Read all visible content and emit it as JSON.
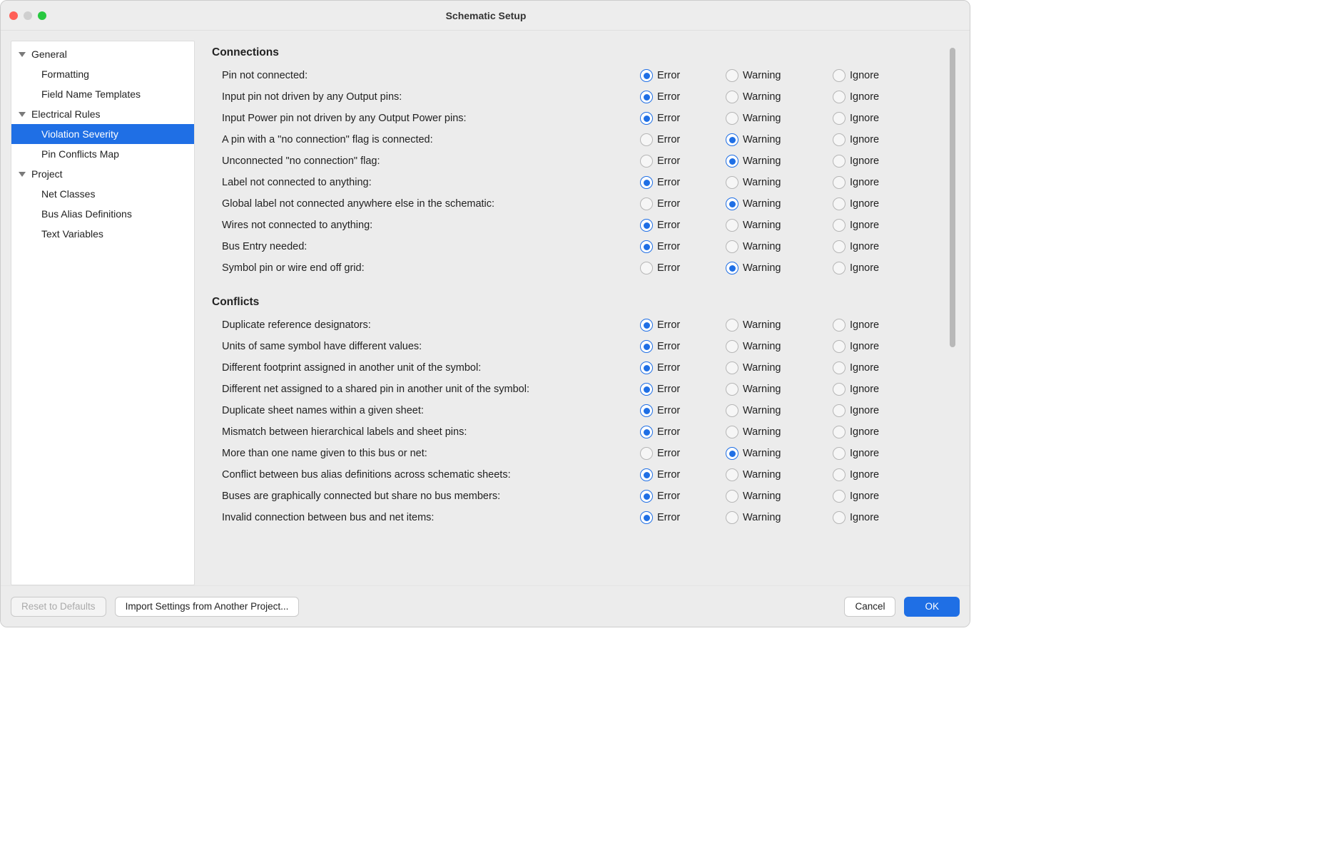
{
  "window": {
    "title": "Schematic Setup"
  },
  "sidebar": [
    {
      "label": "General",
      "indent": 0,
      "expandable": true,
      "selected": false
    },
    {
      "label": "Formatting",
      "indent": 1,
      "expandable": false,
      "selected": false
    },
    {
      "label": "Field Name Templates",
      "indent": 1,
      "expandable": false,
      "selected": false
    },
    {
      "label": "Electrical Rules",
      "indent": 0,
      "expandable": true,
      "selected": false
    },
    {
      "label": "Violation Severity",
      "indent": 1,
      "expandable": false,
      "selected": true
    },
    {
      "label": "Pin Conflicts Map",
      "indent": 1,
      "expandable": false,
      "selected": false
    },
    {
      "label": "Project",
      "indent": 0,
      "expandable": true,
      "selected": false
    },
    {
      "label": "Net Classes",
      "indent": 1,
      "expandable": false,
      "selected": false
    },
    {
      "label": "Bus Alias Definitions",
      "indent": 1,
      "expandable": false,
      "selected": false
    },
    {
      "label": "Text Variables",
      "indent": 1,
      "expandable": false,
      "selected": false
    }
  ],
  "options": {
    "error": "Error",
    "warning": "Warning",
    "ignore": "Ignore"
  },
  "sections": [
    {
      "title": "Connections",
      "rules": [
        {
          "label": "Pin not connected:",
          "value": "error"
        },
        {
          "label": "Input pin not driven by any Output pins:",
          "value": "error"
        },
        {
          "label": "Input Power pin not driven by any Output Power pins:",
          "value": "error"
        },
        {
          "label": "A pin with a \"no connection\" flag is connected:",
          "value": "warning"
        },
        {
          "label": "Unconnected \"no connection\" flag:",
          "value": "warning"
        },
        {
          "label": "Label not connected to anything:",
          "value": "error"
        },
        {
          "label": "Global label not connected anywhere else in the schematic:",
          "value": "warning"
        },
        {
          "label": "Wires not connected to anything:",
          "value": "error"
        },
        {
          "label": "Bus Entry needed:",
          "value": "error"
        },
        {
          "label": "Symbol pin or wire end off grid:",
          "value": "warning"
        }
      ]
    },
    {
      "title": "Conflicts",
      "rules": [
        {
          "label": "Duplicate reference designators:",
          "value": "error"
        },
        {
          "label": "Units of same symbol have different values:",
          "value": "error"
        },
        {
          "label": "Different footprint assigned in another unit of the symbol:",
          "value": "error"
        },
        {
          "label": "Different net assigned to a shared pin in another unit of the symbol:",
          "value": "error"
        },
        {
          "label": "Duplicate sheet names within a given sheet:",
          "value": "error"
        },
        {
          "label": "Mismatch between hierarchical labels and sheet pins:",
          "value": "error"
        },
        {
          "label": "More than one name given to this bus or net:",
          "value": "warning"
        },
        {
          "label": "Conflict between bus alias definitions across schematic sheets:",
          "value": "error"
        },
        {
          "label": "Buses are graphically connected but share no bus members:",
          "value": "error"
        },
        {
          "label": "Invalid connection between bus and net items:",
          "value": "error"
        }
      ]
    }
  ],
  "footer": {
    "reset": "Reset to Defaults",
    "import": "Import Settings from Another Project...",
    "cancel": "Cancel",
    "ok": "OK"
  }
}
